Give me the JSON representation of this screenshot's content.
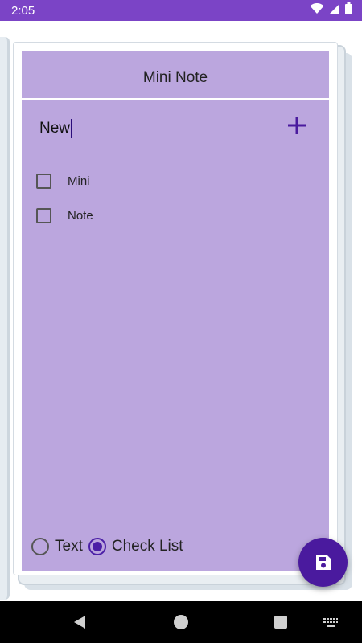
{
  "status_bar": {
    "time": "2:05",
    "background": "#7b44c6"
  },
  "note": {
    "title": "Mini Note",
    "surface_color": "#bba6de",
    "new_item_value": "New",
    "items": [
      {
        "label": "Mini",
        "checked": false
      },
      {
        "label": "Note",
        "checked": false
      }
    ]
  },
  "mode_options": [
    {
      "label": "Text",
      "selected": false
    },
    {
      "label": "Check List",
      "selected": true
    }
  ],
  "icons": {
    "add": "plus-icon",
    "save": "floppy-disk-icon",
    "wifi": "wifi-icon",
    "signal": "signal-icon",
    "battery": "battery-icon",
    "back": "back-triangle-icon",
    "home": "home-circle-icon",
    "recents": "recents-square-icon",
    "keyboard": "keyboard-icon"
  },
  "accent_color": "#4a1a9e"
}
